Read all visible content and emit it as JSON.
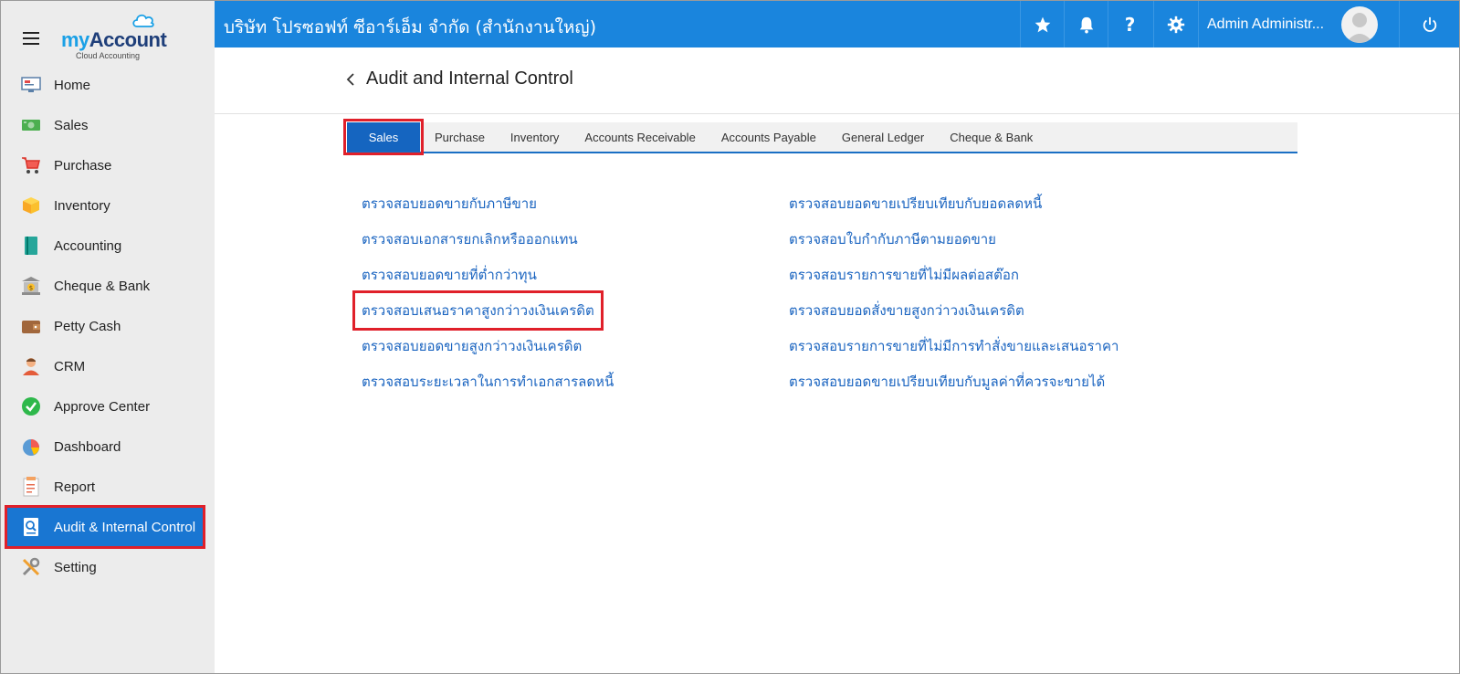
{
  "brand": {
    "name_prefix": "my",
    "name_suffix": "Account",
    "tagline": "Cloud Accounting"
  },
  "sidebar": {
    "items": [
      {
        "label": "Home",
        "icon": "monitor-icon"
      },
      {
        "label": "Sales",
        "icon": "money-icon"
      },
      {
        "label": "Purchase",
        "icon": "cart-icon"
      },
      {
        "label": "Inventory",
        "icon": "box-icon"
      },
      {
        "label": "Accounting",
        "icon": "book-icon"
      },
      {
        "label": "Cheque & Bank",
        "icon": "bank-icon"
      },
      {
        "label": "Petty Cash",
        "icon": "wallet-icon"
      },
      {
        "label": "CRM",
        "icon": "person-icon"
      },
      {
        "label": "Approve Center",
        "icon": "check-circle-icon"
      },
      {
        "label": "Dashboard",
        "icon": "pie-chart-icon"
      },
      {
        "label": "Report",
        "icon": "report-icon"
      },
      {
        "label": "Audit & Internal Control",
        "icon": "audit-icon"
      },
      {
        "label": "Setting",
        "icon": "tools-icon"
      }
    ],
    "active_label": "Audit & Internal Control"
  },
  "topbar": {
    "company": "บริษัท โปรซอฟท์ ซีอาร์เอ็ม จำกัด (สำนักงานใหญ่)",
    "user": "Admin Administr..."
  },
  "page": {
    "title": "Audit and Internal Control"
  },
  "tabs": [
    {
      "label": "Sales",
      "active": true
    },
    {
      "label": "Purchase",
      "active": false
    },
    {
      "label": "Inventory",
      "active": false
    },
    {
      "label": "Accounts Receivable",
      "active": false
    },
    {
      "label": "Accounts Payable",
      "active": false
    },
    {
      "label": "General Ledger",
      "active": false
    },
    {
      "label": "Cheque & Bank",
      "active": false
    }
  ],
  "links": {
    "left": [
      "ตรวจสอบยอดขายกับภาษีขาย",
      "ตรวจสอบเอกสารยกเลิกหรือออกแทน",
      "ตรวจสอบยอดขายที่ต่ำกว่าทุน",
      "ตรวจสอบเสนอราคาสูงกว่าวงเงินเครดิต",
      "ตรวจสอบยอดขายสูงกว่าวงเงินเครดิต",
      "ตรวจสอบระยะเวลาในการทำเอกสารลดหนี้"
    ],
    "right": [
      "ตรวจสอบยอดขายเปรียบเทียบกับยอดลดหนี้",
      "ตรวจสอบใบกำกับภาษีตามยอดขาย",
      "ตรวจสอบรายการขายที่ไม่มีผลต่อสต๊อก",
      "ตรวจสอบยอดสั่งขายสูงกว่าวงเงินเครดิต",
      "ตรวจสอบรายการขายที่ไม่มีการทำสั่งขายและเสนอราคา",
      "ตรวจสอบยอดขายเปรียบเทียบกับมูลค่าที่ควรจะขายได้"
    ]
  },
  "colors": {
    "topbar": "#1a85dd",
    "active": "#1976d2",
    "highlight": "#e0202a",
    "link": "#1a64c0"
  }
}
